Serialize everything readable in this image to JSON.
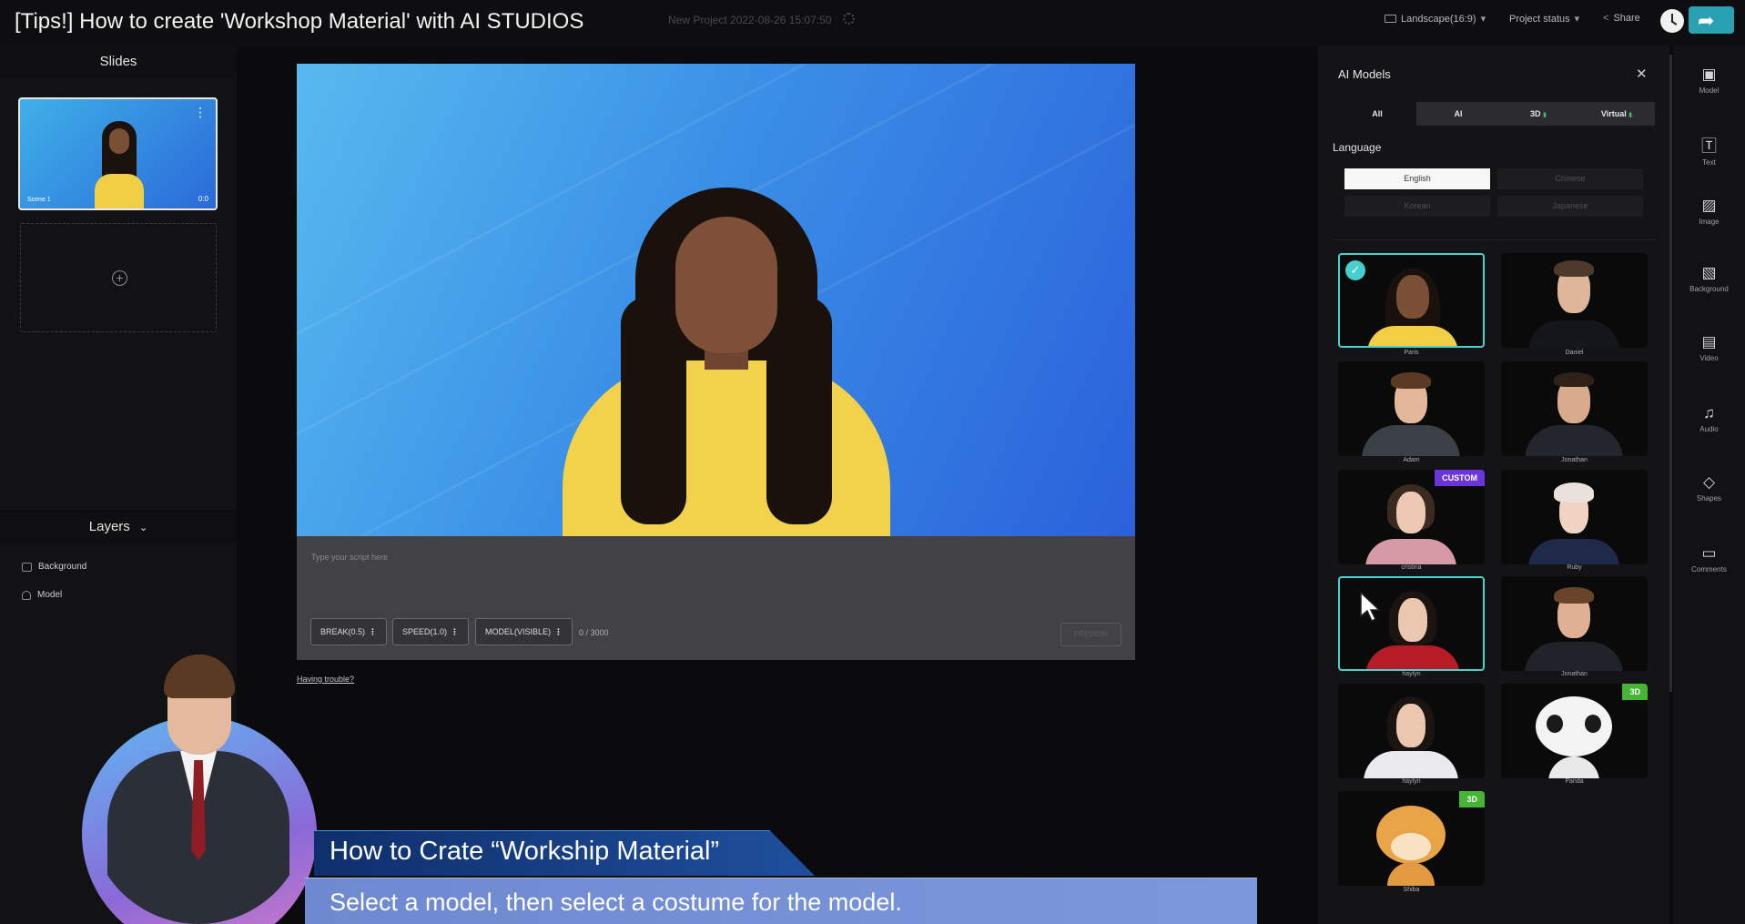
{
  "video_title": "[Tips!] How to create 'Workshop Material' with AI STUDIOS",
  "topbar": {
    "project_name": "New Project 2022-08-26 15:07:50",
    "aspect_ratio": "Landscape(16:9)",
    "project_status": "Project status",
    "share": "Share"
  },
  "slides": {
    "header": "Slides",
    "items": [
      {
        "label": "Scene 1",
        "duration": "0:0"
      }
    ]
  },
  "layers": {
    "header": "Layers",
    "items": [
      {
        "label": "Background"
      },
      {
        "label": "Model"
      }
    ]
  },
  "editor": {
    "script_placeholder": "Type your script here",
    "chips": [
      "BREAK(0.5)",
      "SPEED(1.0)",
      "MODEL(VISIBLE)"
    ],
    "char_count": "0 / 3000",
    "preview": "PREVIEW",
    "help_link": "Having trouble?"
  },
  "ai_models": {
    "title": "AI Models",
    "filters": [
      "All",
      "AI",
      "3D",
      "Virtual"
    ],
    "active_filter": "All",
    "language_label": "Language",
    "languages": [
      "English",
      "Chinese",
      "Korean",
      "Japanese"
    ],
    "active_language": "English",
    "models": [
      {
        "name": "Paris"
      },
      {
        "name": "Daniel"
      },
      {
        "name": "Adam"
      },
      {
        "name": "Jonathan"
      },
      {
        "name": "cristina",
        "tag": "CUSTOM"
      },
      {
        "name": "Ruby"
      },
      {
        "name": "haylyn"
      },
      {
        "name": "Jonathan"
      },
      {
        "name": "haylyn"
      },
      {
        "name": "Panda",
        "tag": "3D"
      },
      {
        "name": "Shiba",
        "tag": "3D"
      }
    ]
  },
  "tools": [
    "Model",
    "Text",
    "Image",
    "Background",
    "Video",
    "Audio",
    "Shapes",
    "Comments"
  ],
  "tutorial": {
    "title": "How to Crate “Workship Material”",
    "subtitle": "Select a model, then select a costume for the model."
  },
  "colors": {
    "accent": "#49d2cf",
    "custom_tag": "#6b36d8",
    "tag_3d": "#46b535",
    "canvas_bg": "#3a8fe6"
  }
}
